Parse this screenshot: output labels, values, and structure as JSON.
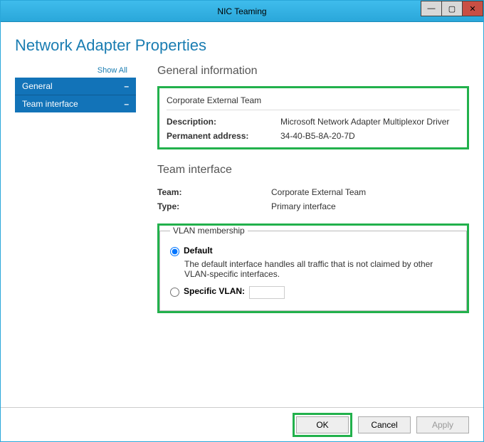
{
  "window": {
    "title": "NIC Teaming"
  },
  "page": {
    "heading": "Network Adapter Properties"
  },
  "sidebar": {
    "show_all": "Show All",
    "items": [
      {
        "label": "General",
        "indicator": "–"
      },
      {
        "label": "Team interface",
        "indicator": "–"
      }
    ]
  },
  "sections": {
    "general": {
      "heading": "General information",
      "name": "Corporate External Team",
      "rows": [
        {
          "label": "Description:",
          "value": "Microsoft Network Adapter Multiplexor Driver"
        },
        {
          "label": "Permanent address:",
          "value": "34-40-B5-8A-20-7D"
        }
      ]
    },
    "team_interface": {
      "heading": "Team interface",
      "rows": [
        {
          "label": "Team:",
          "value": "Corporate External Team"
        },
        {
          "label": "Type:",
          "value": "Primary interface"
        }
      ],
      "vlan": {
        "legend": "VLAN membership",
        "default_label": "Default",
        "default_desc": "The default interface handles all traffic that is not claimed by other VLAN-specific interfaces.",
        "specific_label": "Specific VLAN:",
        "specific_value": "",
        "selected": "default"
      }
    }
  },
  "footer": {
    "ok": "OK",
    "cancel": "Cancel",
    "apply": "Apply"
  }
}
